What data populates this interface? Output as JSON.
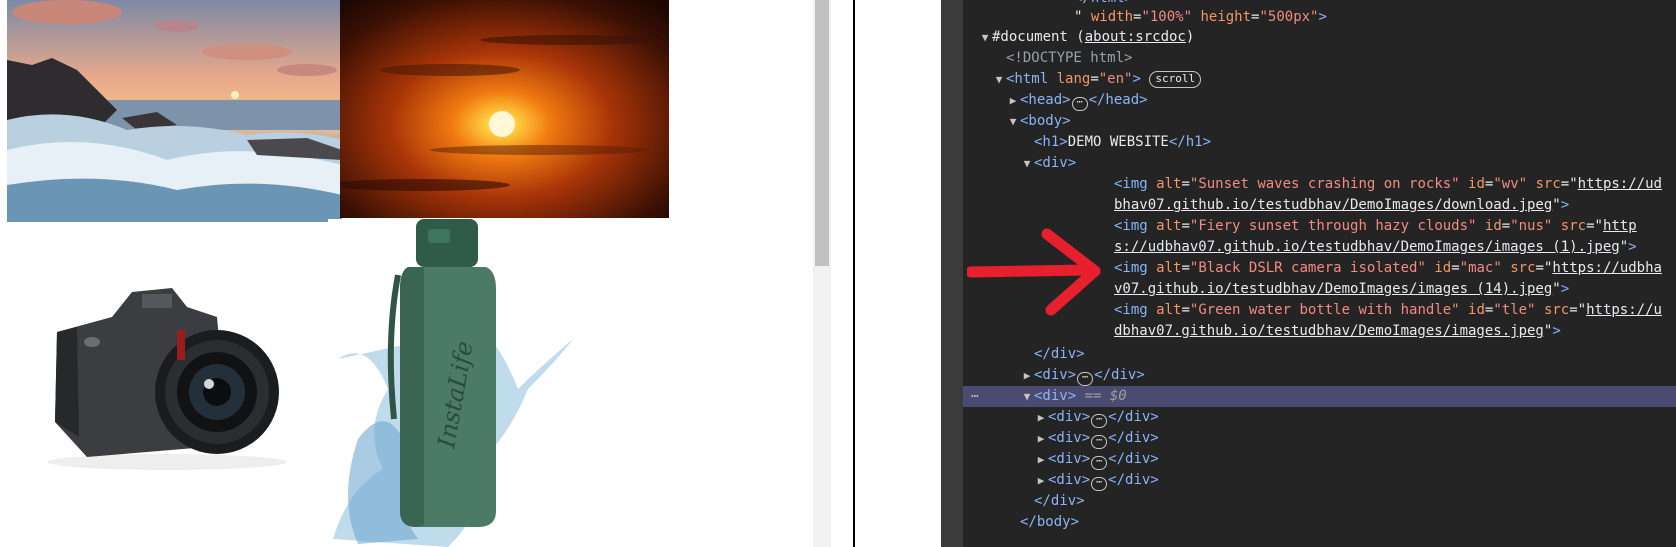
{
  "page": {
    "images": [
      {
        "alt": "Sunset waves crashing on rocks",
        "id": "wv"
      },
      {
        "alt": "Fiery sunset through hazy clouds",
        "id": "nus"
      },
      {
        "alt": "Black DSLR camera isolated",
        "id": "mac"
      },
      {
        "alt": "Green water bottle with handle",
        "id": "tle"
      }
    ],
    "bottle_brand": "InstaLife"
  },
  "devtools": {
    "l0": "</html>",
    "l1": {
      "prefix": "\" ",
      "attr1": "width",
      "val1": "\"100%\"",
      "attr2": "height",
      "val2": "\"500px\"",
      "suffix": ">"
    },
    "l2": {
      "text": "#document (",
      "link": "about:srcdoc",
      "close": ")"
    },
    "l3": "<!DOCTYPE html>",
    "l4": {
      "tag": "<html",
      "attr": "lang",
      "val": "\"en\"",
      "close": ">",
      "badge": "scroll"
    },
    "l5": {
      "open": "<head>",
      "ell": "⋯",
      "close": "</head>"
    },
    "l6": "<body>",
    "l7": {
      "open": "<h1>",
      "text": "DEMO WEBSITE",
      "close": "</h1>"
    },
    "l8": "<div>",
    "img1": {
      "tag": "<img",
      "alt_attr": "alt",
      "alt": "\"Sunset waves crashing on rocks\"",
      "id_attr": "id",
      "id": "\"wv\"",
      "src_attr": "src",
      "src": "https://udbhav07.github.io/testudbhav/DemoImages/download.jpeg",
      "close": ">"
    },
    "img2": {
      "tag": "<img",
      "alt_attr": "alt",
      "alt": "\"Fiery sunset through hazy clouds\"",
      "id_attr": "id",
      "id": "\"nus\"",
      "src_attr": "src",
      "src": "https://udbhav07.github.io/testudbhav/DemoImages/images (1).jpeg",
      "close": ">"
    },
    "img3": {
      "tag": "<img",
      "alt_attr": "alt",
      "alt": "\"Black DSLR camera isolated\"",
      "id_attr": "id",
      "id": "\"mac\"",
      "src_attr": "src",
      "src": "https://udbhav07.github.io/testudbhav/DemoImages/images (14).jpeg",
      "close": ">"
    },
    "img4": {
      "tag": "<img",
      "alt_attr": "alt",
      "alt": "\"Green water bottle with handle\"",
      "id_attr": "id",
      "id": "\"tle\"",
      "src_attr": "src",
      "src": "https://udbhav07.github.io/testudbhav/DemoImages/images.jpeg",
      "close": ">"
    },
    "l17": "</div>",
    "l18": {
      "open": "<div>",
      "ell": "⋯",
      "close": "</div>"
    },
    "l19": {
      "dots": "⋯",
      "open": "<div>",
      "eq": " == ",
      "var": "$0"
    },
    "l20": {
      "open": "<div>",
      "ell": "⋯",
      "close": "</div>"
    },
    "l21": {
      "open": "<div>",
      "ell": "⋯",
      "close": "</div>"
    },
    "l22": {
      "open": "<div>",
      "ell": "⋯",
      "close": "</div>"
    },
    "l23": {
      "open": "<div>",
      "ell": "⋯",
      "close": "</div>"
    },
    "l24": "</div>",
    "l25": "</body>"
  },
  "colors": {
    "devtools_bg": "#242424",
    "tag": "#8ab4f8",
    "attr": "#f29766",
    "value": "#f28b82",
    "selected_row": "#4b4b71",
    "arrow": "#e8202e"
  }
}
